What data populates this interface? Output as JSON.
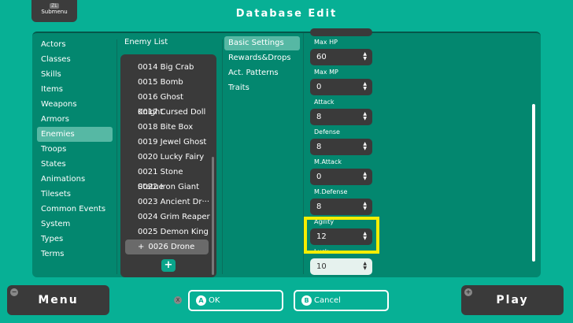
{
  "submenu": {
    "key": "ZL",
    "label": "Submenu"
  },
  "title": "Database Edit",
  "categories": [
    "Actors",
    "Classes",
    "Skills",
    "Items",
    "Weapons",
    "Armors",
    "Enemies",
    "Troops",
    "States",
    "Animations",
    "Tilesets",
    "Common Events",
    "System",
    "Types",
    "Terms"
  ],
  "selected_category": "Enemies",
  "enemy_list": {
    "header": "Enemy List",
    "items": [
      "0014 Big Crab",
      "0015 Bomb",
      "0016 Ghost Knight",
      "0017 Cursed Doll",
      "0018 Bite Box",
      "0019 Jewel Ghost",
      "0020 Lucky Fairy",
      "0021 Stone Statue",
      "0022 Iron Giant",
      "0023 Ancient Dr···",
      "0024 Grim Reaper",
      "0025 Demon King",
      "0026 Drone"
    ],
    "selected_marker": "+",
    "add_label": "+"
  },
  "tabs": [
    "Basic Settings",
    "Rewards&Drops",
    "Act. Patterns",
    "Traits"
  ],
  "fields": [
    {
      "label": "Max HP",
      "value": "60"
    },
    {
      "label": "Max MP",
      "value": "0"
    },
    {
      "label": "Attack",
      "value": "8"
    },
    {
      "label": "Defense",
      "value": "8"
    },
    {
      "label": "M.Attack",
      "value": "0"
    },
    {
      "label": "M.Defense",
      "value": "8"
    },
    {
      "label": "Agility",
      "value": "12"
    },
    {
      "label": "Luck",
      "value": "10"
    }
  ],
  "highlight_color": "#f5ee00",
  "footer": {
    "menu": "Menu",
    "menu_key": "−",
    "play": "Play",
    "play_key": "+",
    "x_key": "X",
    "ok_key": "A",
    "ok": "OK",
    "cancel_key": "B",
    "cancel": "Cancel"
  }
}
